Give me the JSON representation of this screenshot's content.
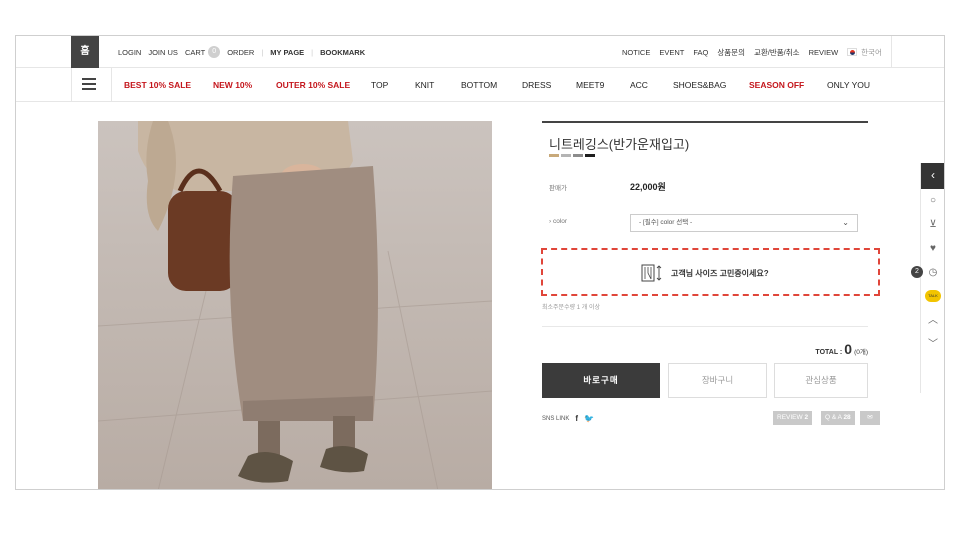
{
  "topbar": {
    "home_label": "홈",
    "login": "LOGIN",
    "join": "JOIN US",
    "cart": "CART",
    "cart_count": "0",
    "order": "ORDER",
    "mypage": "MY PAGE",
    "bookmark": "BOOKMARK",
    "notice": "NOTICE",
    "event": "EVENT",
    "faq": "FAQ",
    "product_qna": "상품문의",
    "exchange": "교환/반품/취소",
    "review": "REVIEW",
    "language": "한국어"
  },
  "categories": [
    {
      "label": "BEST 10% SALE",
      "highlight": true
    },
    {
      "label": "NEW 10%",
      "highlight": true
    },
    {
      "label": "OUTER 10% SALE",
      "highlight": true
    },
    {
      "label": "TOP",
      "highlight": false
    },
    {
      "label": "KNIT",
      "highlight": false
    },
    {
      "label": "BOTTOM",
      "highlight": false
    },
    {
      "label": "DRESS",
      "highlight": false
    },
    {
      "label": "MEET9",
      "highlight": false
    },
    {
      "label": "ACC",
      "highlight": false
    },
    {
      "label": "SHOES&BAG",
      "highlight": false
    },
    {
      "label": "SEASON OFF",
      "highlight": true
    },
    {
      "label": "ONLY YOU",
      "highlight": false
    }
  ],
  "product": {
    "name": "니트레깅스(반가운재입고)",
    "swatch_colors": [
      "#c8a97a",
      "#b4b4b4",
      "#8c8c8c",
      "#1e1e1e"
    ],
    "price_label": "판매가",
    "price": "22,000원",
    "option_label": "› color",
    "option_placeholder": "- [필수] color 선택 -",
    "size_helper": "고객님 사이즈 고민중이세요?",
    "min_qty": "최소주문수량 1 개 이상",
    "total_label": "TOTAL :",
    "total_value": "0",
    "total_count": "(0개)",
    "buy_now": "바로구매",
    "add_cart": "장바구니",
    "wishlist": "관심상품",
    "sns_label": "SNS LINK",
    "review_button": "REVIEW",
    "review_count": "2",
    "qna_button": "Q & A",
    "qna_count": "28"
  },
  "quickbar": {
    "badge": "2",
    "talk": "TALK"
  }
}
